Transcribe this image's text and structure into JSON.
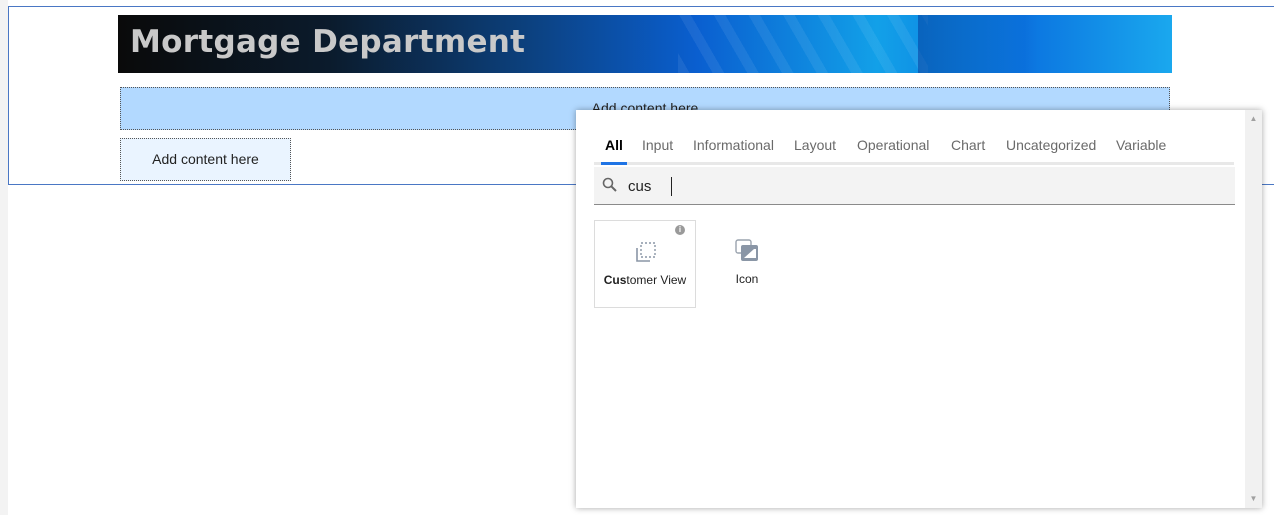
{
  "banner": {
    "title": "Mortgage Department"
  },
  "content": {
    "placeholder_wide": "Add content here",
    "placeholder_small": "Add content here"
  },
  "picker": {
    "tabs": [
      {
        "label": "All",
        "active": true
      },
      {
        "label": "Input"
      },
      {
        "label": "Informational"
      },
      {
        "label": "Layout"
      },
      {
        "label": "Operational"
      },
      {
        "label": "Chart"
      },
      {
        "label": "Uncategorized"
      },
      {
        "label": "Variable"
      }
    ],
    "search": {
      "value": "cus"
    },
    "results": [
      {
        "match": "Cus",
        "rest": "tomer View",
        "icon": "customer-view-icon"
      },
      {
        "match": "",
        "rest": "Icon",
        "icon": "image-icon"
      }
    ]
  },
  "colors": {
    "accent": "#1f74e5",
    "wide_block": "#b2d9ff",
    "small_block": "#eaf4ff",
    "frame": "#4a77c4"
  }
}
